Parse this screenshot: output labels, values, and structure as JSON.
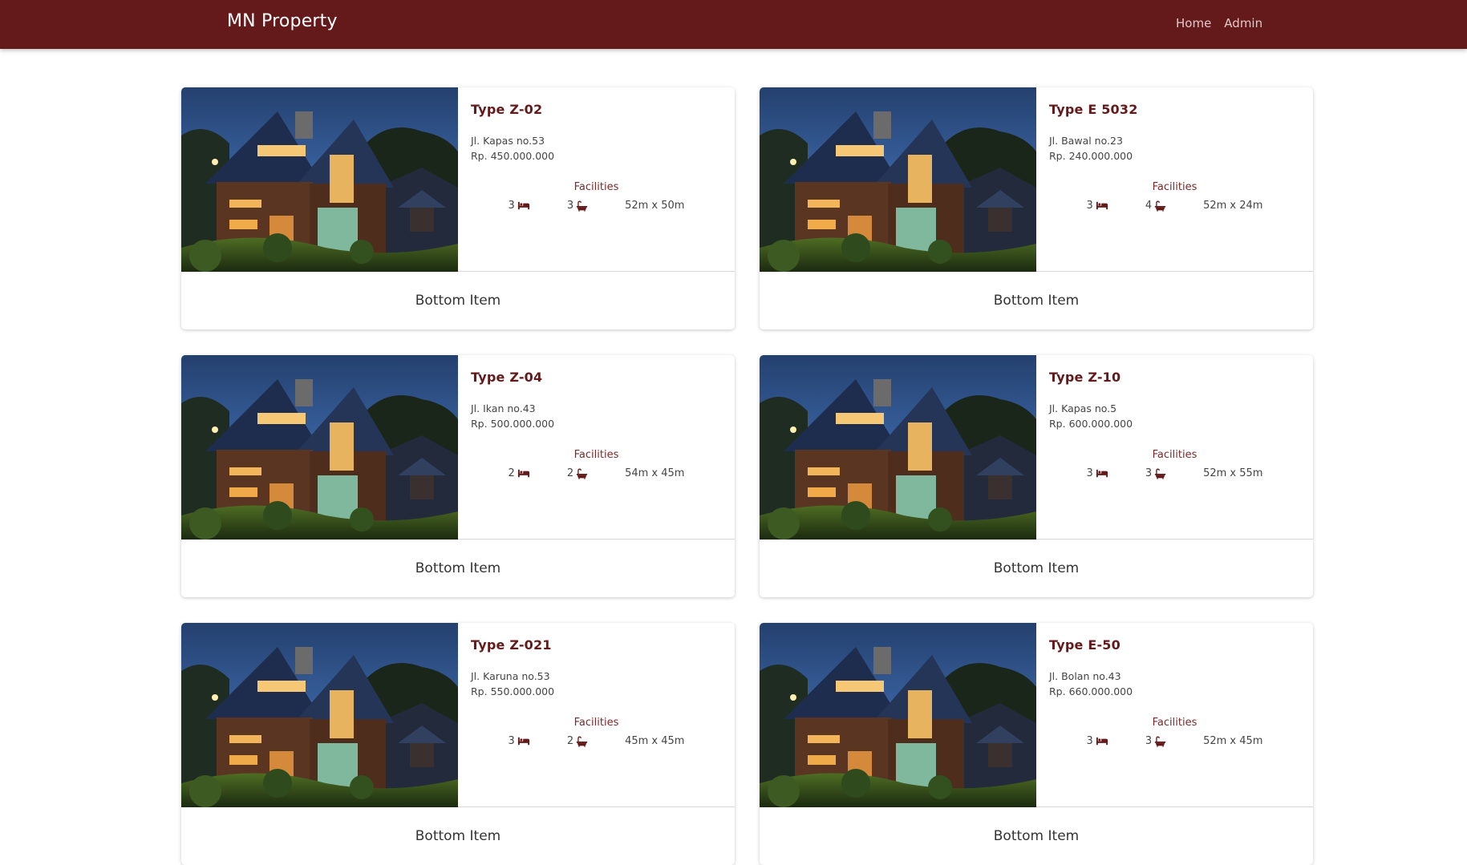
{
  "navbar": {
    "brand": "MN Property",
    "links": [
      "Home",
      "Admin"
    ]
  },
  "colors": {
    "brand": "#641a1a",
    "accent_text": "#7a2a2a"
  },
  "icons": {
    "bed": "bed-icon",
    "bath": "bath-icon"
  },
  "listings": [
    {
      "title": "Type Z-02",
      "address": "Jl. Kapas no.53",
      "price": "Rp. 450.000.000",
      "facilities_label": "Facilities",
      "beds": "3",
      "baths": "3",
      "size": "52m x 50m",
      "footer": "Bottom Item"
    },
    {
      "title": "Type E 5032",
      "address": "Jl. Bawal no.23",
      "price": "Rp. 240.000.000",
      "facilities_label": "Facilities",
      "beds": "3",
      "baths": "4",
      "size": "52m x 24m",
      "footer": "Bottom Item"
    },
    {
      "title": "Type Z-04",
      "address": "Jl. Ikan no.43",
      "price": "Rp. 500.000.000",
      "facilities_label": "Facilities",
      "beds": "2",
      "baths": "2",
      "size": "54m x 45m",
      "footer": "Bottom Item"
    },
    {
      "title": "Type Z-10",
      "address": "Jl. Kapas no.5",
      "price": "Rp. 600.000.000",
      "facilities_label": "Facilities",
      "beds": "3",
      "baths": "3",
      "size": "52m x 55m",
      "footer": "Bottom Item"
    },
    {
      "title": "Type Z-021",
      "address": "Jl. Karuna no.53",
      "price": "Rp. 550.000.000",
      "facilities_label": "Facilities",
      "beds": "3",
      "baths": "2",
      "size": "45m x 45m",
      "footer": "Bottom Item"
    },
    {
      "title": "Type E-50",
      "address": "Jl. Bolan no.43",
      "price": "Rp. 660.000.000",
      "facilities_label": "Facilities",
      "beds": "3",
      "baths": "3",
      "size": "52m x 45m",
      "footer": "Bottom Item"
    }
  ]
}
